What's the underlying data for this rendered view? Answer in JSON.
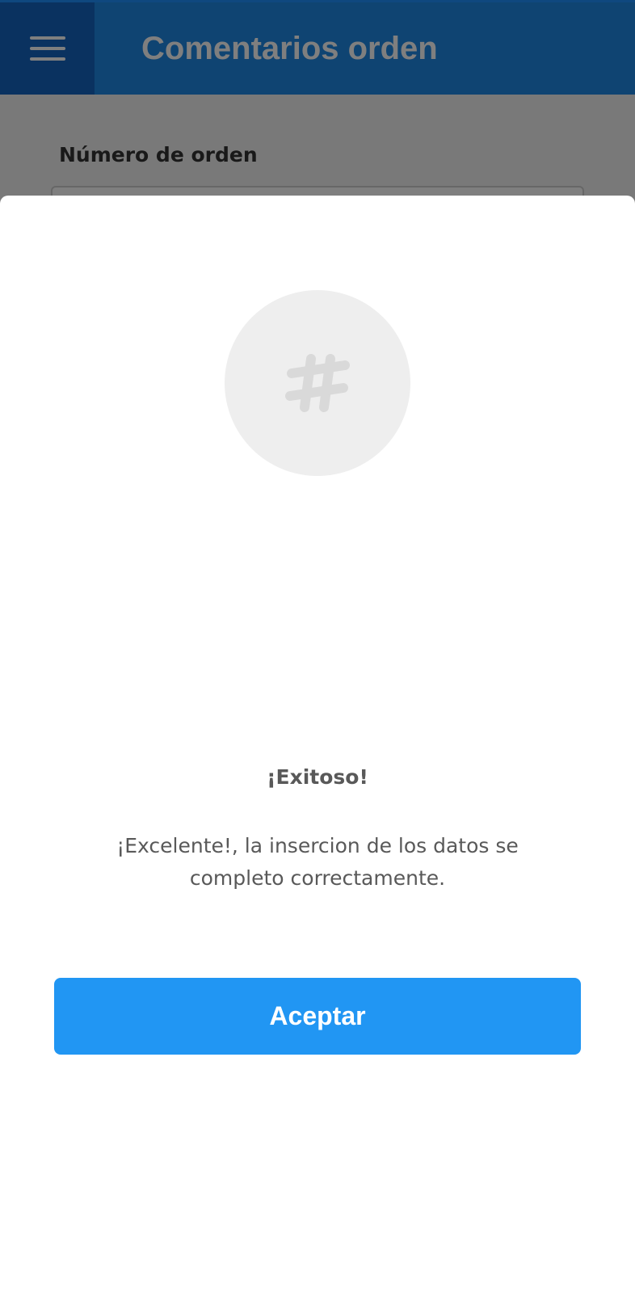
{
  "appbar": {
    "title": "Comentarios orden",
    "menu_icon": "hamburger-menu-icon"
  },
  "form": {
    "order_number_label": "Número de orden"
  },
  "dialog": {
    "icon": "hashtag-icon",
    "title": "¡Exitoso!",
    "message": "¡Excelente!, la insercion de los datos se completo correctamente.",
    "accept_label": "Aceptar"
  },
  "colors": {
    "appbar": "#1e88e5",
    "menu_button": "#1565c0",
    "accept_button": "#2196f3",
    "scrim": "rgba(0,0,0,0.5)"
  }
}
